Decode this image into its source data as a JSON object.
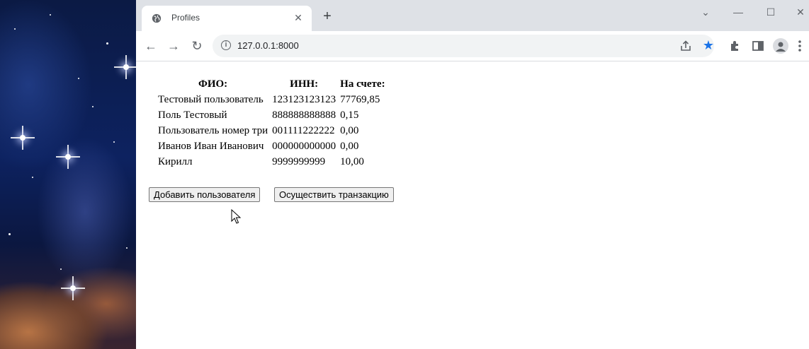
{
  "browser": {
    "tab_title": "Profiles",
    "new_tab_symbol": "+",
    "url": "127.0.0.1:8000",
    "accent_color": "#1a73e8"
  },
  "table": {
    "headers": [
      "ФИО:",
      "ИНН:",
      "На счете:"
    ],
    "rows": [
      [
        "Тестовый пользователь",
        "123123123123",
        "77769,85"
      ],
      [
        "Поль Тестовый",
        "888888888888",
        "0,15"
      ],
      [
        "Пользователь номер три",
        "001111222222",
        "0,00"
      ],
      [
        "Иванов Иван Иванович",
        "000000000000",
        "0,00"
      ],
      [
        "Кирилл",
        "9999999999",
        "10,00"
      ]
    ]
  },
  "actions": {
    "add_user": "Добавить пользователя",
    "transaction": "Осуществить транзакцию"
  }
}
